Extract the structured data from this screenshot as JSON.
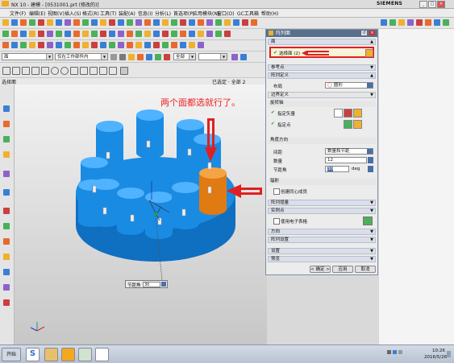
{
  "window": {
    "title": "NX 10 - 建模 - [0531001.prt (修改的)]",
    "brand": "SIEMENS",
    "controls": [
      "_",
      "□",
      "×"
    ]
  },
  "menubar": {
    "items": [
      "文件(F)",
      "编辑(E)",
      "视图(V)",
      "插入(S)",
      "格式(R)",
      "工具(T)",
      "装配(A)",
      "信息(I)",
      "分析(L)",
      "首选项(P)",
      "应用模块(N)",
      "窗口(O)",
      "GC工具箱",
      "帮助(H)"
    ]
  },
  "selectionbar": {
    "filter_value": "面",
    "scope_value": "仅在工作部件内",
    "assembly_value": "全部"
  },
  "viewport": {
    "header_left": "选择面",
    "header_right": "已选定 · 全部 2",
    "annotation": "两个面都选就行了。",
    "angle_label": "节距角",
    "angle_value": "30"
  },
  "dialog": {
    "title": "阵列面",
    "face_section": "面",
    "face_select": "选择面 (2)",
    "ref_point": "参考点",
    "array_def": "阵列定义",
    "layout_label": "布局",
    "layout_value": "圆形",
    "boundary": "边界定义",
    "rotation_axis": "旋转轴",
    "spec_vector": "指定矢量",
    "spec_point": "指定点",
    "angle_dir": "角度方向",
    "spacing_label": "间距",
    "spacing_value": "数量和节距",
    "count_label": "数量",
    "count_value": "12",
    "pitch_label": "节距角",
    "pitch_value": "30",
    "pitch_unit": "deg",
    "radiate": "辐射",
    "create_concentric": "创建同心成员",
    "array_increment": "阵列增量",
    "instance_point": "实例点",
    "use_spreadsheet": "使用电子表格",
    "orientation": "方向",
    "array_settings": "阵列设置",
    "settings": "设置",
    "preview": "预览",
    "ok": "< 确定 >",
    "apply": "应用",
    "cancel": "取消"
  },
  "taskbar": {
    "start": "开始",
    "time": "10:26",
    "date": "2016/5/26"
  },
  "colors": {
    "part_blue": "#1a8be3",
    "selected_face": "#f08c1e",
    "arrow_red": "#e02020",
    "annotation_red": "#ee2222"
  }
}
